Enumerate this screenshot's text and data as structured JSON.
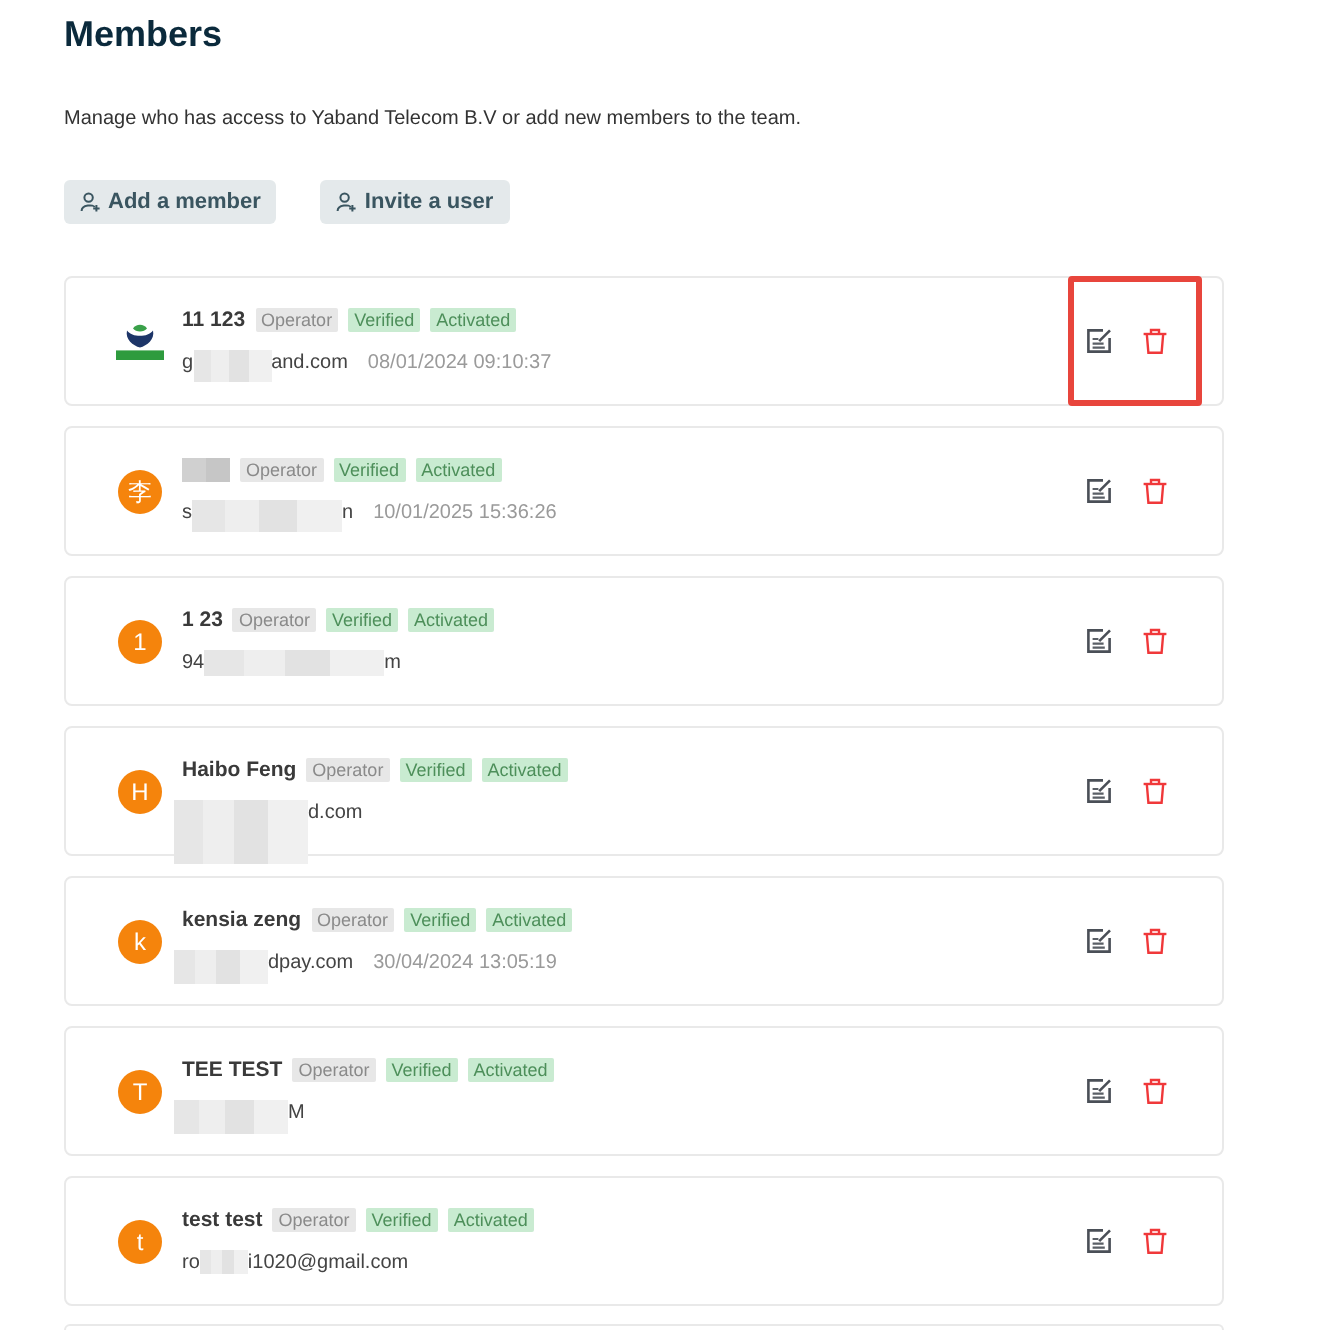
{
  "page": {
    "title": "Members",
    "description": "Manage who has access to Yaband Telecom B.V or add new members to the team."
  },
  "actions": [
    {
      "label": "Add a member"
    },
    {
      "label": "Invite a user"
    }
  ],
  "members": [
    {
      "avatar": {
        "kind": "logo"
      },
      "name_parts": [
        {
          "kind": "text",
          "text": "11 123"
        }
      ],
      "tags": [
        {
          "kind": "role",
          "text": "Operator"
        },
        {
          "kind": "status",
          "text": "Verified"
        },
        {
          "kind": "status",
          "text": "Activated"
        }
      ],
      "email_parts": [
        {
          "kind": "text",
          "text": "g"
        },
        {
          "kind": "redacted"
        },
        {
          "kind": "text",
          "text": "and.com"
        }
      ],
      "date": "08/01/2024 09:10:37",
      "highlighted": true
    },
    {
      "avatar": {
        "kind": "initial",
        "text": "李"
      },
      "name_parts": [
        {
          "kind": "redacted"
        }
      ],
      "tags": [
        {
          "kind": "role",
          "text": "Operator"
        },
        {
          "kind": "status",
          "text": "Verified"
        },
        {
          "kind": "status",
          "text": "Activated"
        }
      ],
      "email_parts": [
        {
          "kind": "text",
          "text": "s"
        },
        {
          "kind": "redacted"
        },
        {
          "kind": "text",
          "text": "n"
        }
      ],
      "date": "10/01/2025 15:36:26",
      "highlighted": false
    },
    {
      "avatar": {
        "kind": "initial",
        "text": "1"
      },
      "name_parts": [
        {
          "kind": "text",
          "text": "1 23"
        }
      ],
      "tags": [
        {
          "kind": "role",
          "text": "Operator"
        },
        {
          "kind": "status",
          "text": "Verified"
        },
        {
          "kind": "status",
          "text": "Activated"
        }
      ],
      "email_parts": [
        {
          "kind": "text",
          "text": "94"
        },
        {
          "kind": "redacted"
        },
        {
          "kind": "text",
          "text": "m"
        }
      ],
      "highlighted": false
    },
    {
      "avatar": {
        "kind": "initial",
        "text": "H"
      },
      "name_parts": [
        {
          "kind": "text",
          "text": "Haibo Feng"
        }
      ],
      "tags": [
        {
          "kind": "role",
          "text": "Operator"
        },
        {
          "kind": "status",
          "text": "Verified"
        },
        {
          "kind": "status",
          "text": "Activated"
        }
      ],
      "email_parts": [
        {
          "kind": "redacted"
        },
        {
          "kind": "text",
          "text": "d.com"
        }
      ],
      "highlighted": false
    },
    {
      "avatar": {
        "kind": "initial",
        "text": "k"
      },
      "name_parts": [
        {
          "kind": "text",
          "text": "kensia zeng"
        }
      ],
      "tags": [
        {
          "kind": "role",
          "text": "Operator"
        },
        {
          "kind": "status",
          "text": "Verified"
        },
        {
          "kind": "status",
          "text": "Activated"
        }
      ],
      "email_parts": [
        {
          "kind": "redacted"
        },
        {
          "kind": "text",
          "text": "dpay.com"
        }
      ],
      "date": "30/04/2024 13:05:19",
      "highlighted": false
    },
    {
      "avatar": {
        "kind": "initial",
        "text": "T"
      },
      "name_parts": [
        {
          "kind": "text",
          "text": "TEE TEST"
        }
      ],
      "tags": [
        {
          "kind": "role",
          "text": "Operator"
        },
        {
          "kind": "status",
          "text": "Verified"
        },
        {
          "kind": "status",
          "text": "Activated"
        }
      ],
      "email_parts": [
        {
          "kind": "redacted"
        },
        {
          "kind": "text",
          "text": "M"
        }
      ],
      "highlighted": false
    },
    {
      "avatar": {
        "kind": "initial",
        "text": "t"
      },
      "name_parts": [
        {
          "kind": "text",
          "text": "test test"
        }
      ],
      "tags": [
        {
          "kind": "role",
          "text": "Operator"
        },
        {
          "kind": "status",
          "text": "Verified"
        },
        {
          "kind": "status",
          "text": "Activated"
        }
      ],
      "email_parts": [
        {
          "kind": "text",
          "text": "ro"
        },
        {
          "kind": "redacted"
        },
        {
          "kind": "text",
          "text": "i1020@gmail.com"
        }
      ],
      "highlighted": false
    }
  ],
  "next_card_cut_off": true
}
